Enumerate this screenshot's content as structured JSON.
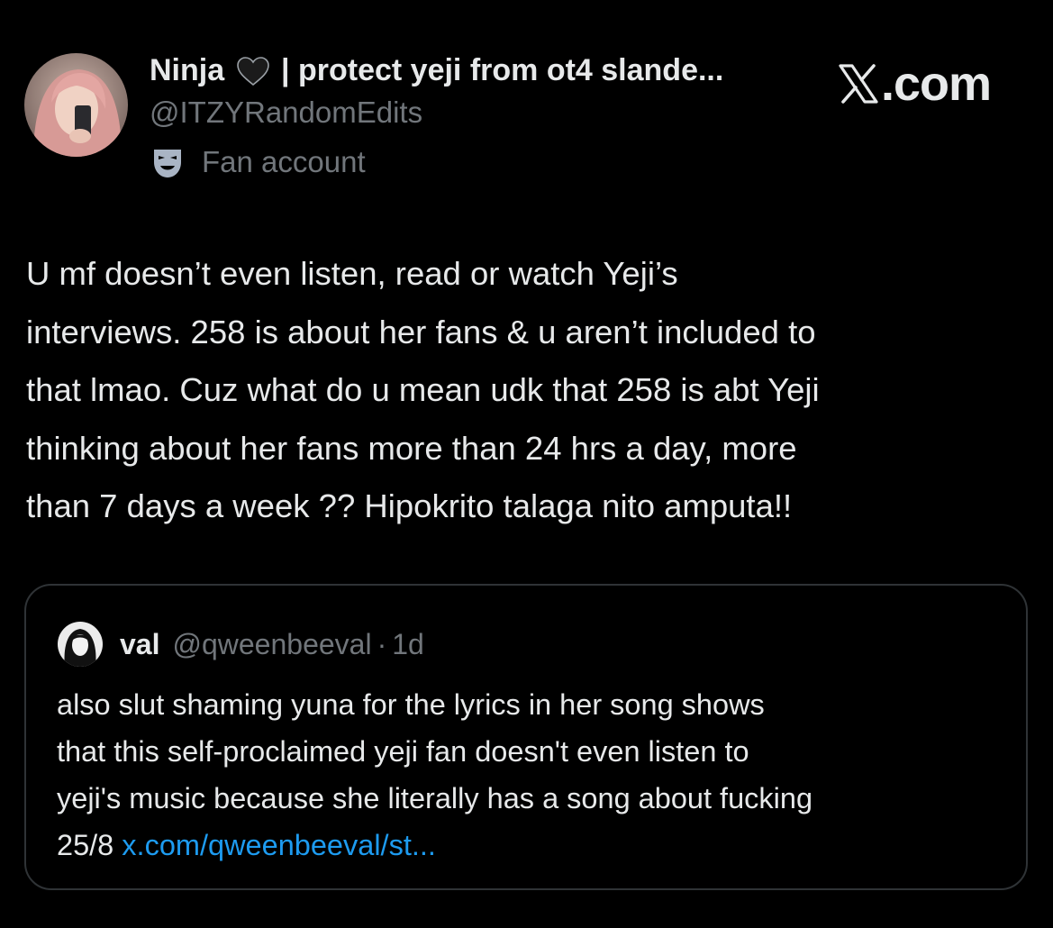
{
  "author": {
    "display_name": "Ninja",
    "name_suffix": "| protect yeji from ot4 slande...",
    "handle": "@ITZYRandomEdits",
    "affiliation_label": "Fan account",
    "affiliation_icon": "theater-mask-icon",
    "heart_icon": "black-heart-icon"
  },
  "brand": {
    "logo_icon": "x-logo-icon",
    "domain": ".com"
  },
  "tweet": {
    "text": "U mf doesn’t even listen, read or watch Yeji’s\ninterviews. 258 is about her fans & u aren’t included to\nthat lmao. Cuz what do u mean udk that 258 is abt Yeji\nthinking about her fans more than 24 hrs a day, more\nthan 7 days a week ?? Hipokrito talaga nito amputa!!"
  },
  "quoted_tweet": {
    "display_name": "val",
    "handle": "@qweenbeeval",
    "separator": "·",
    "time": "1d",
    "text": "also slut shaming yuna for the lyrics in her song shows\nthat this self-proclaimed yeji fan doesn't even listen to\nyeji's music because she literally has a song about fucking\n25/8 ",
    "link_text": "x.com/qweenbeeval/st..."
  },
  "colors": {
    "background": "#000000",
    "primary_text": "#e7e9ea",
    "secondary_text": "#71767b",
    "link": "#1d9bf0",
    "border": "#2f3336"
  }
}
